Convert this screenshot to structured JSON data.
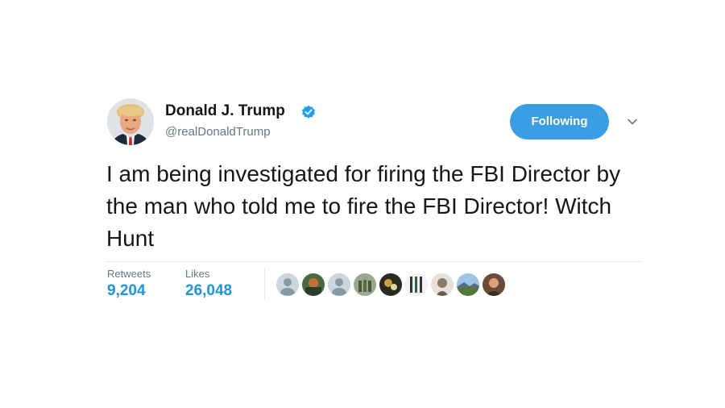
{
  "tweet": {
    "author_name": "Donald J. Trump",
    "author_handle": "@realDonaldTrump",
    "follow_label": "Following",
    "text": "I am being investigated for firing the FBI Director by the man who told me to fire the FBI Director! Witch Hunt",
    "stats": {
      "retweets_label": "Retweets",
      "retweets_value": "9,204",
      "likes_label": "Likes",
      "likes_value": "26,048"
    },
    "likers_count": 10
  },
  "colors": {
    "accent": "#1b95e0",
    "follow_button": "#3a9ee5",
    "text": "#14171a",
    "muted": "#657786",
    "divider": "#e1e8ed"
  },
  "icons": {
    "verified": "verified-badge-icon",
    "caret": "chevron-down-icon"
  }
}
